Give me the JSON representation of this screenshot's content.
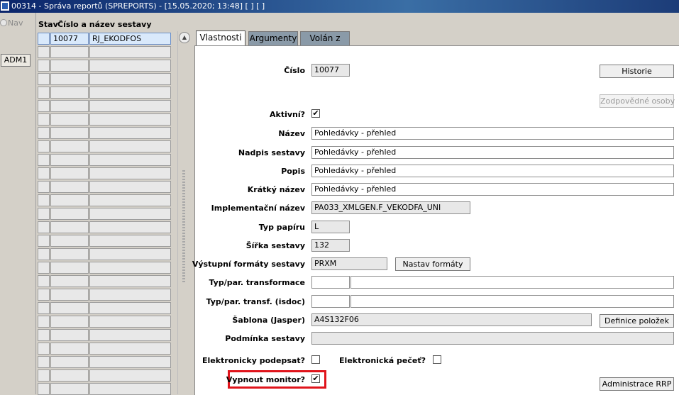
{
  "window": {
    "title": "00314 - Správa reportů (SPREPORTS) - [15.05.2020; 13:48]  [ ]  [ ]"
  },
  "left": {
    "nav_label": "Nav",
    "adm_button": "ADM1"
  },
  "grid": {
    "col_stav": "Stav",
    "col_name": "Číslo a název sestavy",
    "selected_row": {
      "number": "10077",
      "code": "RJ_EKODFOS"
    }
  },
  "tabs": [
    {
      "label": "Vlastnosti",
      "active": true
    },
    {
      "label": "Argumenty",
      "active": false
    },
    {
      "label": "Volán z",
      "active": false
    }
  ],
  "form": {
    "cislo": {
      "label": "Číslo",
      "value": "10077"
    },
    "historie_btn": "Historie",
    "zodpovedne_btn": "Zodpovědné osoby",
    "aktivni": {
      "label": "Aktivní?",
      "checked": true,
      "mark": "✔"
    },
    "nazev": {
      "label": "Název",
      "value": "Pohledávky - přehled"
    },
    "nadpis": {
      "label": "Nadpis sestavy",
      "value": "Pohledávky - přehled"
    },
    "popis": {
      "label": "Popis",
      "value": "Pohledávky - přehled"
    },
    "kratky": {
      "label": "Krátký název",
      "value": "Pohledávky - přehled"
    },
    "impl": {
      "label": "Implementační název",
      "value": "PA033_XMLGEN.F_VEKODFA_UNI"
    },
    "typ_papiru": {
      "label": "Typ papíru",
      "value": "L"
    },
    "sirka": {
      "label": "Šířka sestavy",
      "value": "132"
    },
    "vystupni": {
      "label": "Výstupní formáty sestavy",
      "value": "PRXM"
    },
    "nastav_btn": "Nastav formáty",
    "typ_transf": {
      "label": "Typ/par. transformace",
      "value": ""
    },
    "typ_isdoc": {
      "label": "Typ/par. transf. (isdoc)",
      "value": ""
    },
    "sablona": {
      "label": "Šablona (Jasper)",
      "value": "A4S132F06"
    },
    "definice_btn": "Definice položek",
    "podminka": {
      "label": "Podmínka sestavy",
      "value": ""
    },
    "el_podepsat": {
      "label": "Elektronicky podepsat?",
      "checked": false
    },
    "el_pecet": {
      "label": "Elektronická pečeť?",
      "checked": false
    },
    "vypnout": {
      "label": "Vypnout monitor?",
      "checked": true,
      "mark": "✔"
    },
    "admin_btn": "Administrace RRP"
  },
  "colors": {
    "highlight": "#e0141b",
    "titlebar": "#0a246a"
  }
}
